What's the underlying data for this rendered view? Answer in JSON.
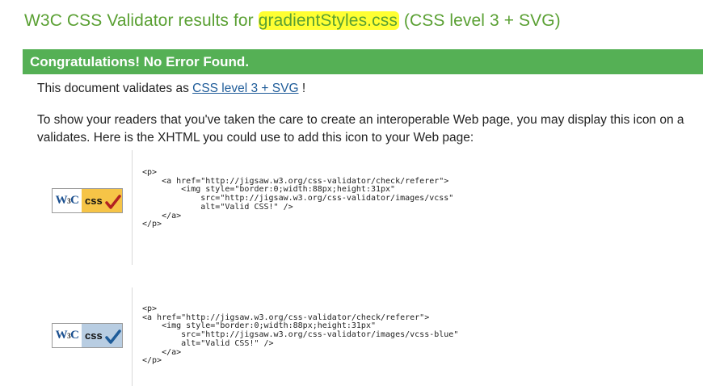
{
  "header": {
    "title_prefix": "W3C CSS Validator results for ",
    "file_name": "gradientStyles.css",
    "title_suffix": " (CSS level 3 + SVG)"
  },
  "banner": {
    "text": "Congratulations! No Error Found."
  },
  "validation": {
    "prefix": "This document validates as ",
    "level_link": "CSS level 3 + SVG",
    "suffix": " !"
  },
  "readers_text": {
    "line1": "To show your readers that you've taken the care to create an interoperable Web page, you may display this icon on a",
    "line2": "validates. Here is the XHTML you could use to add this icon to your Web page:"
  },
  "badges": [
    {
      "w3c_w": "W",
      "w3c_3": "3",
      "w3c_c": "C",
      "css_label": "css",
      "check_color": "#b22222",
      "code": "<p>\n    <a href=\"http://jigsaw.w3.org/css-validator/check/referer\">\n        <img style=\"border:0;width:88px;height:31px\"\n            src=\"http://jigsaw.w3.org/css-validator/images/vcss\"\n            alt=\"Valid CSS!\" />\n    </a>\n</p>"
    },
    {
      "w3c_w": "W",
      "w3c_3": "3",
      "w3c_c": "C",
      "css_label": "css",
      "check_color": "#1f5c99",
      "code": "<p>\n<a href=\"http://jigsaw.w3.org/css-validator/check/referer\">\n    <img style=\"border:0;width:88px;height:31px\"\n        src=\"http://jigsaw.w3.org/css-validator/images/vcss-blue\"\n        alt=\"Valid CSS!\" />\n    </a>\n</p>"
    }
  ]
}
